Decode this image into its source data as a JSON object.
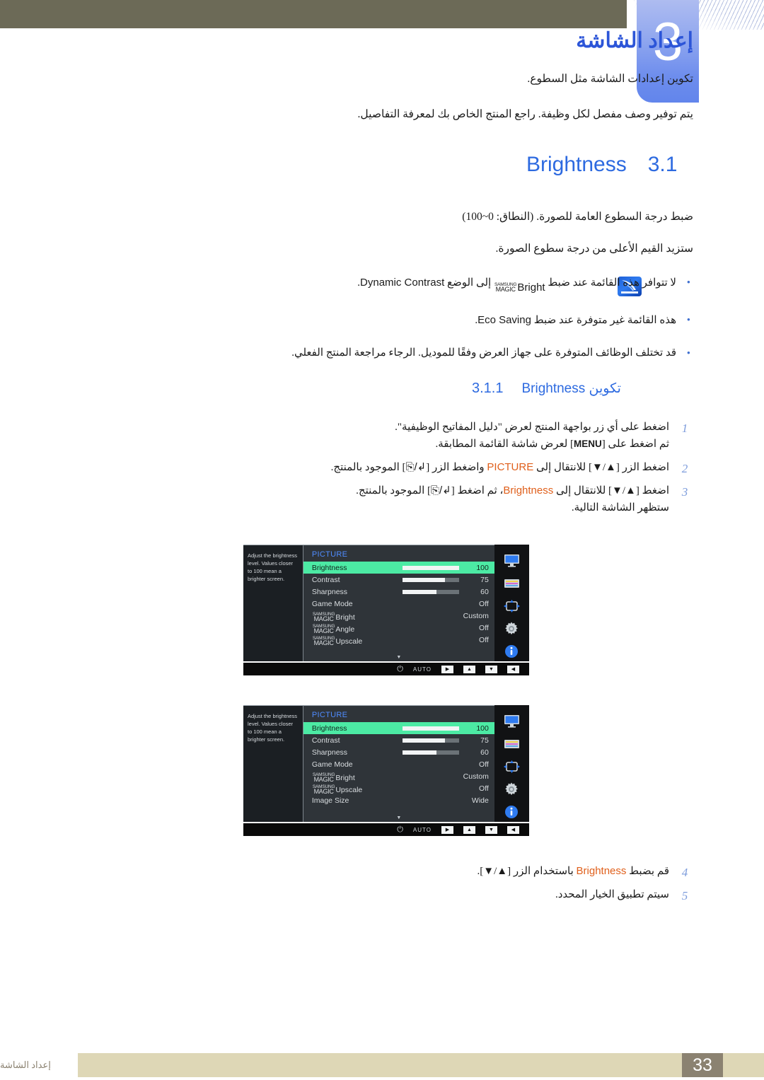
{
  "chapter": {
    "number": "3",
    "title": "إعداد الشاشة",
    "intro1": "تكوين إعدادات الشاشة مثل السطوع.",
    "intro2": "يتم توفير وصف مفصل لكل وظيفة. راجع المنتج الخاص بك لمعرفة التفاصيل."
  },
  "section": {
    "number": "3.1",
    "title": "Brightness",
    "body1": "ضبط درجة السطوع العامة للصورة. (النطاق: 0~100)",
    "body2": "ستزيد القيم الأعلى من درجة سطوع الصورة."
  },
  "notes": {
    "icon": "samsung-note-icon",
    "items": [
      {
        "pre": "لا تتوافر هذه القائمة عند ضبط ",
        "magic_top": "SAMSUNG",
        "magic_bottom": "MAGIC",
        "magic_word": "Bright",
        "mid": " إلى الوضع ",
        "en": "Dynamic Contrast",
        "post": "."
      },
      {
        "pre": "هذه القائمة غير متوفرة عند ضبط ",
        "en": "Eco Saving",
        "post": "."
      },
      {
        "pre": "قد تختلف الوظائف المتوفرة على جهاز العرض وفقًا للموديل. الرجاء مراجعة المنتج الفعلي.",
        "en": "",
        "post": ""
      }
    ]
  },
  "subsection": {
    "number": "3.1.1",
    "title_ar": "تكوين",
    "title_en": "Brightness"
  },
  "steps": [
    {
      "n": "1",
      "line1": "اضغط على أي زر بواجهة المنتج لعرض \"دليل المفاتيح الوظيفية\".",
      "line2_a": "ثم اضغط على [",
      "line2_key": "MENU",
      "line2_b": "] لعرض شاشة القائمة المطابقة."
    },
    {
      "n": "2",
      "a": "اضغط الزر [▲/▼] للانتقال إلى ",
      "en": "PICTURE",
      "b": " واضغط الزر [",
      "c": "] الموجود بالمنتج."
    },
    {
      "n": "3",
      "a": "اضغط [▲/▼] للانتقال إلى ",
      "en": "Brightness",
      "b": "، ثم اضغط [",
      "c": "] الموجود بالمنتج.",
      "sub": "ستظهر الشاشة التالية."
    }
  ],
  "steps_late": [
    {
      "n": "4",
      "a": "قم بضبط ",
      "en": "Brightness",
      "b": " باستخدام الزر [▲/▼]."
    },
    {
      "n": "5",
      "a": "سيتم تطبيق الخيار المحدد.",
      "en": "",
      "b": ""
    }
  ],
  "osd": {
    "title": "PICTURE",
    "help": "Adjust the brightness level. Values closer to 100 mean a brighter screen.",
    "icons": [
      "monitor-icon",
      "color-bars-icon",
      "move-arrows-icon",
      "gear-icon",
      "info-icon"
    ],
    "bottom_keys": [
      "◀",
      "▼",
      "▲",
      "▶"
    ],
    "auto_label": "AUTO",
    "power_icon": "power-icon",
    "scroll_icon": "▼",
    "accent_selected": "#4ceaa4",
    "menu1": [
      {
        "label": "Brightness",
        "value": "100",
        "slider": 100,
        "selected": true
      },
      {
        "label": "Contrast",
        "value": "75",
        "slider": 75,
        "selected": false
      },
      {
        "label": "Sharpness",
        "value": "60",
        "slider": 60,
        "selected": false
      },
      {
        "label": "Game Mode",
        "value": "Off",
        "slider": null,
        "selected": false
      },
      {
        "label": "Bright",
        "value": "Custom",
        "slider": null,
        "selected": false,
        "magic": true
      },
      {
        "label": "Angle",
        "value": "Off",
        "slider": null,
        "selected": false,
        "magic": true
      },
      {
        "label": "Upscale",
        "value": "Off",
        "slider": null,
        "selected": false,
        "magic": true
      }
    ],
    "menu2": [
      {
        "label": "Brightness",
        "value": "100",
        "slider": 100,
        "selected": true
      },
      {
        "label": "Contrast",
        "value": "75",
        "slider": 75,
        "selected": false
      },
      {
        "label": "Sharpness",
        "value": "60",
        "slider": 60,
        "selected": false
      },
      {
        "label": "Game Mode",
        "value": "Off",
        "slider": null,
        "selected": false
      },
      {
        "label": "Bright",
        "value": "Custom",
        "slider": null,
        "selected": false,
        "magic": true
      },
      {
        "label": "Upscale",
        "value": "Off",
        "slider": null,
        "selected": false,
        "magic": true
      },
      {
        "label": "Image Size",
        "value": "Wide",
        "slider": null,
        "selected": false
      }
    ],
    "magic_top": "SAMSUNG",
    "magic_bottom": "MAGIC"
  },
  "footer": {
    "page": "33",
    "text": "إعداد الشاشة"
  }
}
